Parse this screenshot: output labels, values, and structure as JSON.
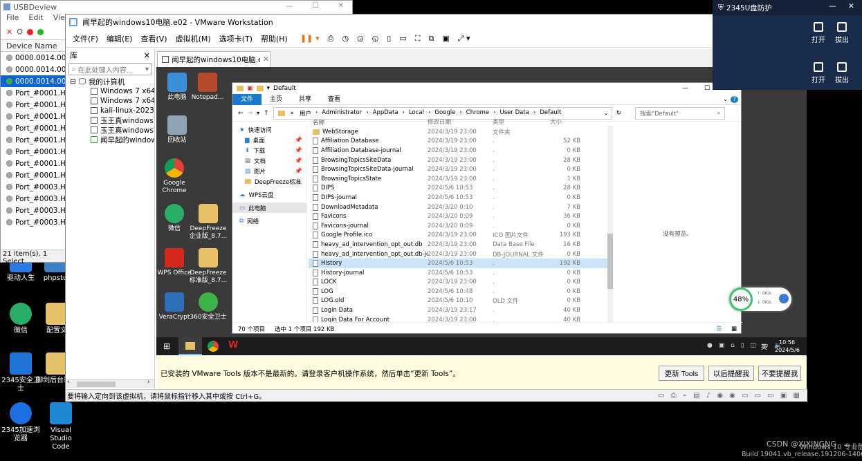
{
  "host": {
    "icons": [
      {
        "label": "驱动人生"
      },
      {
        "label": "phpstu"
      },
      {
        "label": "微信"
      },
      {
        "label": "配置文"
      },
      {
        "label": "2345安全卫士"
      },
      {
        "label": "御剑后台珍藏"
      },
      {
        "label": "2345加速浏览器"
      },
      {
        "label": "Visual Studio Code"
      }
    ],
    "watermark": "CSDN @XIXINGNG",
    "winver1": "Windows 10 专业版",
    "winver2": "Build 19041.vb_release.191206-1406"
  },
  "usbdeview": {
    "title": "USBDeview",
    "menu": [
      "File",
      "Edit",
      "View"
    ],
    "column": "Device Name",
    "rows": [
      {
        "name": "0000.0014.0000",
        "color": "#aaaaaa"
      },
      {
        "name": "0000.0014.0000",
        "color": "#aaaaaa"
      },
      {
        "name": "0000.0014.0000",
        "color": "#22c322"
      },
      {
        "name": "Port_#0001.Hub",
        "color": "#aaaaaa"
      },
      {
        "name": "Port_#0001.Hub",
        "color": "#aaaaaa"
      },
      {
        "name": "Port_#0001.Hub",
        "color": "#aaaaaa"
      },
      {
        "name": "Port_#0001.Hub",
        "color": "#aaaaaa"
      },
      {
        "name": "Port_#0001.Hub",
        "color": "#aaaaaa"
      },
      {
        "name": "Port_#0001.Hub",
        "color": "#aaaaaa"
      },
      {
        "name": "Port_#0001.Hub",
        "color": "#aaaaaa"
      },
      {
        "name": "Port_#0001.Hub",
        "color": "#aaaaaa"
      },
      {
        "name": "Port_#0003.Hub",
        "color": "#aaaaaa"
      },
      {
        "name": "Port_#0003.Hub",
        "color": "#aaaaaa"
      },
      {
        "name": "Port_#0003.Hub",
        "color": "#aaaaaa"
      },
      {
        "name": "Port_#0003.Hub",
        "color": "#aaaaaa"
      }
    ],
    "status": "21 item(s), 1 Select"
  },
  "vmware": {
    "title": "闻早起的windows10电脑.e02 - VMware Workstation",
    "menu": [
      "文件(F)",
      "编辑(E)",
      "查看(V)",
      "虚拟机(M)",
      "选项卡(T)",
      "帮助(H)"
    ],
    "library": {
      "title": "库",
      "search_placeholder": "在此处键入内容...",
      "root": "我的计算机",
      "items": [
        "Windows 7 x64",
        "Windows 7 x64",
        "kali-linux-2023.4",
        "玉王真windows7",
        "玉王真windows7",
        "闻早起的windows10"
      ]
    },
    "tab_label": "闻早起的windows10电脑.e02",
    "notify_text": "已安装的 VMware Tools 版本不是最新的。请登录客户机操作系统，然后单击“更新 Tools”。",
    "btn_update": "更新 Tools",
    "btn_later": "以后提醒我",
    "btn_never": "不要提醒我",
    "status_text": "要将输入定向到该虚拟机，请将鼠标指针移入其中或按 Ctrl+G。"
  },
  "guest": {
    "icons": [
      {
        "label": "此电脑"
      },
      {
        "label": "Notepad..."
      },
      {
        "label": "回收站"
      },
      {
        "label": "Google Chrome"
      },
      {
        "label": "微信"
      },
      {
        "label": "DeepFreeze企业版_8.7..."
      },
      {
        "label": "WPS Office"
      },
      {
        "label": "DeepFreeze标准版_8.7..."
      },
      {
        "label": "VeraCrypt"
      },
      {
        "label": "360安全卫士"
      }
    ],
    "clock_time": "10:56",
    "clock_date": "2024/5/6",
    "ime": "英",
    "speed_pct": "48%",
    "speed_up": "0K/s",
    "speed_down": "0K/s"
  },
  "explorer": {
    "title": "Default",
    "ribbon": [
      "文件",
      "主页",
      "共享",
      "查看"
    ],
    "path": [
      "用户",
      "Administrator",
      "AppData",
      "Local",
      "Google",
      "Chrome",
      "User Data",
      "Default"
    ],
    "search_placeholder": "搜索\"Default\"",
    "nav": [
      "快速访问",
      "桌面",
      "下载",
      "文档",
      "图片",
      "DeepFreeze标准版",
      "WPS云盘",
      "此电脑",
      "网络"
    ],
    "columns": [
      "名称",
      "修改日期",
      "类型",
      "大小"
    ],
    "files": [
      {
        "name": "WebStorage",
        "date": "2024/3/19 23:00",
        "type": "文件夹",
        "size": ""
      },
      {
        "name": "Affiliation Database",
        "date": "2024/3/19 23:00",
        "type": ".",
        "size": "52 KB"
      },
      {
        "name": "Affiliation Database-journal",
        "date": "2024/3/19 23:00",
        "type": ".",
        "size": "0 KB"
      },
      {
        "name": "BrowsingTopicsSiteData",
        "date": "2024/3/19 23:00",
        "type": ".",
        "size": "28 KB"
      },
      {
        "name": "BrowsingTopicsSiteData-journal",
        "date": "2024/3/19 23:00",
        "type": ".",
        "size": "0 KB"
      },
      {
        "name": "BrowsingTopicsState",
        "date": "2024/3/19 23:00",
        "type": ".",
        "size": "1 KB"
      },
      {
        "name": "DIPS",
        "date": "2024/5/6 10:53",
        "type": ".",
        "size": "28 KB"
      },
      {
        "name": "DIPS-journal",
        "date": "2024/5/6 10:53",
        "type": ".",
        "size": "0 KB"
      },
      {
        "name": "DownloadMetadata",
        "date": "2024/3/20 0:10",
        "type": ".",
        "size": "7 KB"
      },
      {
        "name": "Favicons",
        "date": "2024/3/20 0:09",
        "type": ".",
        "size": "36 KB"
      },
      {
        "name": "Favicons-journal",
        "date": "2024/3/20 0:09",
        "type": ".",
        "size": "0 KB"
      },
      {
        "name": "Google Profile.ico",
        "date": "2024/3/19 23:00",
        "type": "ICO 图片文件",
        "size": "193 KB"
      },
      {
        "name": "heavy_ad_intervention_opt_out.db",
        "date": "2024/3/19 23:00",
        "type": "Data Base File",
        "size": "16 KB"
      },
      {
        "name": "heavy_ad_intervention_opt_out.db-jou...",
        "date": "2024/3/19 23:00",
        "type": "DB-JOURNAL 文件",
        "size": "0 KB"
      },
      {
        "name": "History",
        "date": "2024/5/6 10:53",
        "type": ".",
        "size": "192 KB"
      },
      {
        "name": "History-journal",
        "date": "2024/5/6 10:53",
        "type": ".",
        "size": "0 KB"
      },
      {
        "name": "LOCK",
        "date": "2024/3/19 23:00",
        "type": ".",
        "size": "0 KB"
      },
      {
        "name": "LOG",
        "date": "2024/5/6 10:48",
        "type": ".",
        "size": "0 KB"
      },
      {
        "name": "LOG.old",
        "date": "2024/5/6 10:10",
        "type": "OLD 文件",
        "size": "0 KB"
      },
      {
        "name": "Login Data",
        "date": "2024/3/19 23:17",
        "type": ".",
        "size": "40 KB"
      },
      {
        "name": "Login Data For Account",
        "date": "2024/3/19 23:00",
        "type": ".",
        "size": "40 KB"
      }
    ],
    "selected_index": 14,
    "preview_text": "没有预览。",
    "status_count": "70 个项目",
    "status_selected": "选中 1 个项目 192 KB"
  },
  "u2345": {
    "title": "2345U盘防护",
    "open1": "打开",
    "eject1": "拔出",
    "open2": "打开",
    "eject2": "拔出"
  },
  "colors": {
    "accent": "#1979ca",
    "selection": "#cce4f7",
    "notify_bg": "#fffbe0"
  }
}
